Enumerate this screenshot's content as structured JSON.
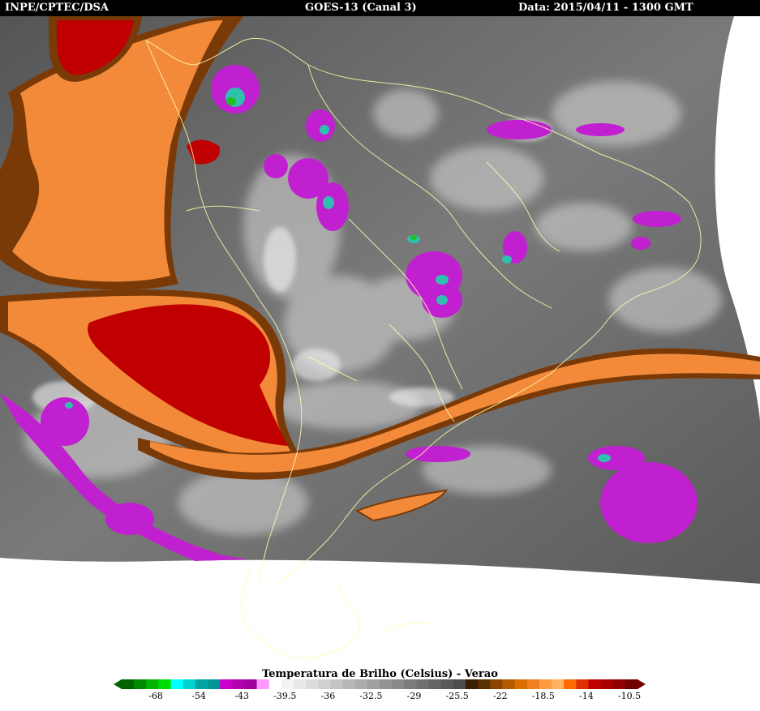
{
  "header": {
    "left": "INPE/CPTEC/DSA",
    "center": "GOES-13 (Canal 3)",
    "right": "Data: 2015/04/11 - 1300 GMT"
  },
  "legend": {
    "title": "Temperatura de Brilho (Celsius) - Verao",
    "ticks": [
      "-68",
      "-54",
      "-43",
      "-39.5",
      "-36",
      "-32.5",
      "-29",
      "-25.5",
      "-22",
      "-18.5",
      "-14",
      "-10.5"
    ],
    "segments": [
      "#006400",
      "#008c00",
      "#00b400",
      "#00dc00",
      "#00ffff",
      "#00d2d2",
      "#00a5a5",
      "#009696",
      "#cc00cc",
      "#b000b0",
      "#a000a0",
      "#ff99ff",
      "#ffffff",
      "#f4f4f4",
      "#e8e8e8",
      "#dcdcdc",
      "#d0d0d0",
      "#c4c4c4",
      "#b8b8b8",
      "#acacac",
      "#a0a0a0",
      "#949494",
      "#888888",
      "#7c7c7c",
      "#707070",
      "#646464",
      "#585858",
      "#4c4c4c",
      "#3a2000",
      "#5a3000",
      "#8a4500",
      "#b35a00",
      "#d96f00",
      "#f08020",
      "#ff9a40",
      "#ffb060",
      "#ff6a00",
      "#e03000",
      "#c00000",
      "#a80000",
      "#900000",
      "#700000"
    ]
  },
  "map_colors": {
    "ocean_ir": "#6b6b6b",
    "land_ir": "#7a7a7a",
    "coastline": "#ffffb0",
    "jet_orange": "#f28a3a",
    "jet_dark": "#7a3a08",
    "cold_red": "#c00000",
    "convective_magenta": "#c020d0",
    "convective_cyan": "#30c0b0",
    "convective_green": "#20c020"
  }
}
